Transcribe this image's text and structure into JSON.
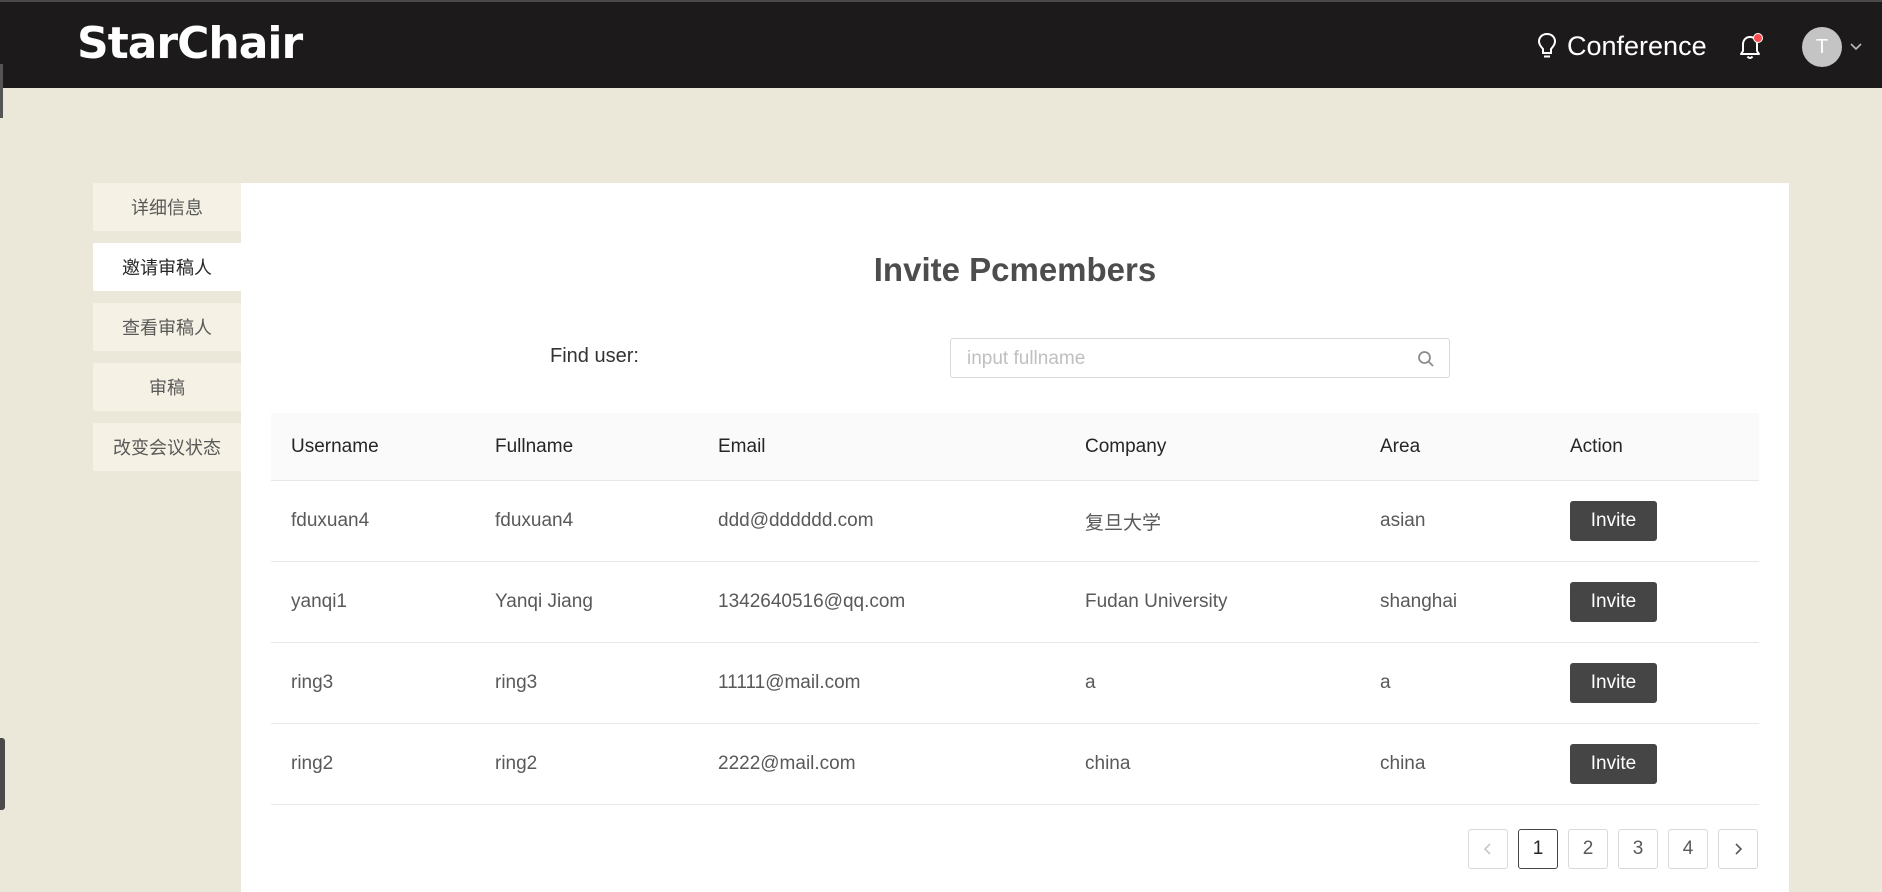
{
  "header": {
    "logo": "StarChair",
    "nav_label": "Conference",
    "avatar_initial": "T",
    "notification_dot": true
  },
  "sidebar": {
    "items": [
      {
        "label": "详细信息",
        "active": false
      },
      {
        "label": "邀请审稿人",
        "active": true
      },
      {
        "label": "查看审稿人",
        "active": false
      },
      {
        "label": "审稿",
        "active": false
      },
      {
        "label": "改变会议状态",
        "active": false
      }
    ]
  },
  "main": {
    "title": "Invite Pcmembers",
    "find_label": "Find user:",
    "search_placeholder": "input fullname",
    "search_value": ""
  },
  "table": {
    "columns": [
      "Username",
      "Fullname",
      "Email",
      "Company",
      "Area",
      "Action"
    ],
    "rows": [
      {
        "username": "fduxuan4",
        "fullname": "fduxuan4",
        "email": "ddd@dddddd.com",
        "company": "复旦大学",
        "area": "asian",
        "action": "Invite"
      },
      {
        "username": "yanqi1",
        "fullname": "Yanqi Jiang",
        "email": "1342640516@qq.com",
        "company": "Fudan University",
        "area": "shanghai",
        "action": "Invite"
      },
      {
        "username": "ring3",
        "fullname": "ring3",
        "email": "11111@mail.com",
        "company": "a",
        "area": "a",
        "action": "Invite"
      },
      {
        "username": "ring2",
        "fullname": "ring2",
        "email": "2222@mail.com",
        "company": "china",
        "area": "china",
        "action": "Invite"
      }
    ]
  },
  "pagination": {
    "prev": "<",
    "pages": [
      "1",
      "2",
      "3",
      "4"
    ],
    "current": "1",
    "next": ">"
  },
  "colors": {
    "topbar": "#1c1a1a",
    "background": "#ebe7d9",
    "button": "#454545",
    "badge": "#ff4d4f"
  }
}
